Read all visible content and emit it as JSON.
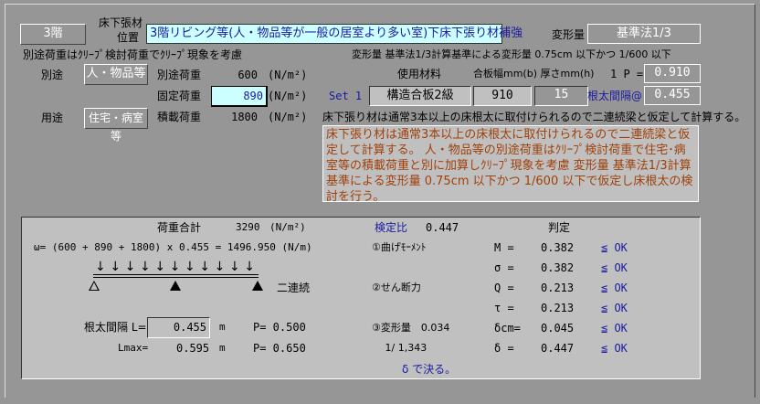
{
  "floor": "3階",
  "location_label1": "床下張材",
  "location_label2": "位置",
  "location_value": "3階リビング等(人・物品等が一般の居室より多い室)下床下張り材補強",
  "deflection_label": "変形量",
  "deflection_value": "基準法1/3",
  "note_creep": "別途荷重はｸﾘｰﾌﾟ検討荷重でｸﾘｰﾌﾟ現象を考慮",
  "note_deflection": "変形量 基準法1/3計算基準による変形量 0.75cm 以下かつ 1/600 以下",
  "loads": {
    "betto_label": "別途",
    "betto_value": "人・物品等",
    "youto_label": "用途",
    "youto_value": "住宅・病室等",
    "rows": [
      {
        "label": "別途荷重",
        "value": "600",
        "unit": "(N/m²)"
      },
      {
        "label": "固定荷重",
        "value": "890",
        "unit": "(N/m²)"
      },
      {
        "label": "積載荷重",
        "value": "1800",
        "unit": "(N/m²)"
      }
    ]
  },
  "material": {
    "header_material": "使用材料",
    "header_dims": "合板幅mm(b) 厚さmm(h)",
    "p_label": "1 P =",
    "p_value": "0.910",
    "set_label": "Set 1",
    "material_value": "構造合板2級",
    "width_value": "910",
    "thickness_value": "15",
    "spacing_label": "根太間隔@",
    "spacing_value": "0.455"
  },
  "assumption": "床下張り材は通常3本以上の床根太に取付けられるので二連続梁と仮定して計算する。",
  "description": "床下張り材は通常3本以上の床根太に取付けられるので二連続梁と仮定して計算する。 人・物品等の別途荷重はｸﾘｰﾌﾟ検討荷重で住宅･病室等の積載荷重と別に加算しｸﾘｰﾌﾟ現象を考慮 変形量 基準法1/3計算基準による変形量 0.75cm 以下かつ 1/600 以下で仮定し床根太の検討を行う。",
  "calc": {
    "total_label": "荷重合計",
    "total_value": "3290",
    "total_unit": "(N/m²)",
    "omega": "ω= (600 + 890 + 1800) x 0.455 =  1496.950 (N/m)",
    "beam_type": "二連続",
    "L_label": "根太間隔 L=",
    "L_value": "0.455",
    "L_unit": "m",
    "P1": "P= 0.500",
    "Lmax_label": "Lmax=",
    "Lmax_value": "0.595",
    "Lmax_unit": "m",
    "P2": "P= 0.650",
    "ratio_label": "検定比",
    "ratio_value": "0.447",
    "judge_label": "判定",
    "rows": [
      {
        "item": "①曲げﾓｰﾒﾝﾄ",
        "sym": "M =",
        "val": "0.382",
        "res": "≦ OK"
      },
      {
        "item": "",
        "sym": "σ =",
        "val": "0.382",
        "res": "≦ OK"
      },
      {
        "item": "②せん断力",
        "sym": "Q =",
        "val": "0.213",
        "res": "≦ OK"
      },
      {
        "item": "",
        "sym": "τ =",
        "val": "0.213",
        "res": "≦ OK"
      },
      {
        "item": "③変形量　0.034",
        "sym": "δcm=",
        "val": "0.045",
        "res": "≦ OK"
      },
      {
        "item": "　 1/ 1,343",
        "sym": "δ =",
        "val": "0.447",
        "res": "≦ OK"
      }
    ],
    "governing": "δ  で決る。"
  }
}
